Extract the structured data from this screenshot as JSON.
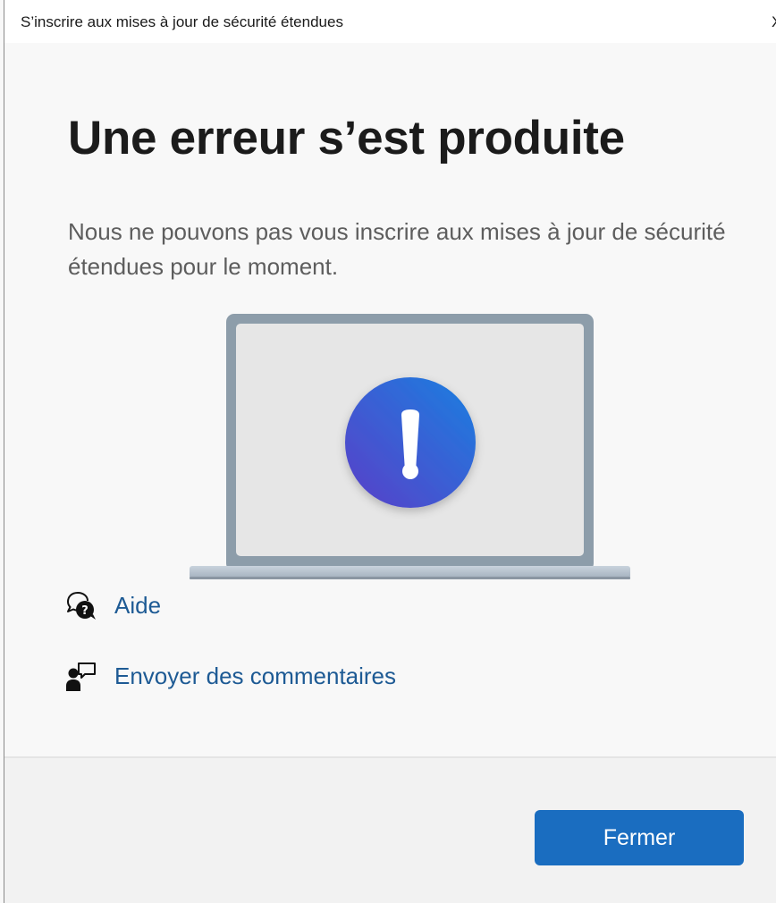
{
  "window": {
    "title": "S’inscrire aux mises à jour de sécurité étendues",
    "close_glyph": "X"
  },
  "main": {
    "heading": "Une erreur s’est produite",
    "message": "Nous ne pouvons pas vous inscrire aux mises à jour de sécurité étendues pour le moment.",
    "illustration": "laptop-error-illustration",
    "links": [
      {
        "label": "Aide",
        "icon": "help-chat-icon"
      },
      {
        "label": "Envoyer des commentaires",
        "icon": "feedback-person-icon"
      }
    ]
  },
  "footer": {
    "close_button_label": "Fermer"
  },
  "colors": {
    "accent": "#1a6dc0",
    "link": "#1d5a94",
    "error_badge": "#3f5ad6"
  }
}
